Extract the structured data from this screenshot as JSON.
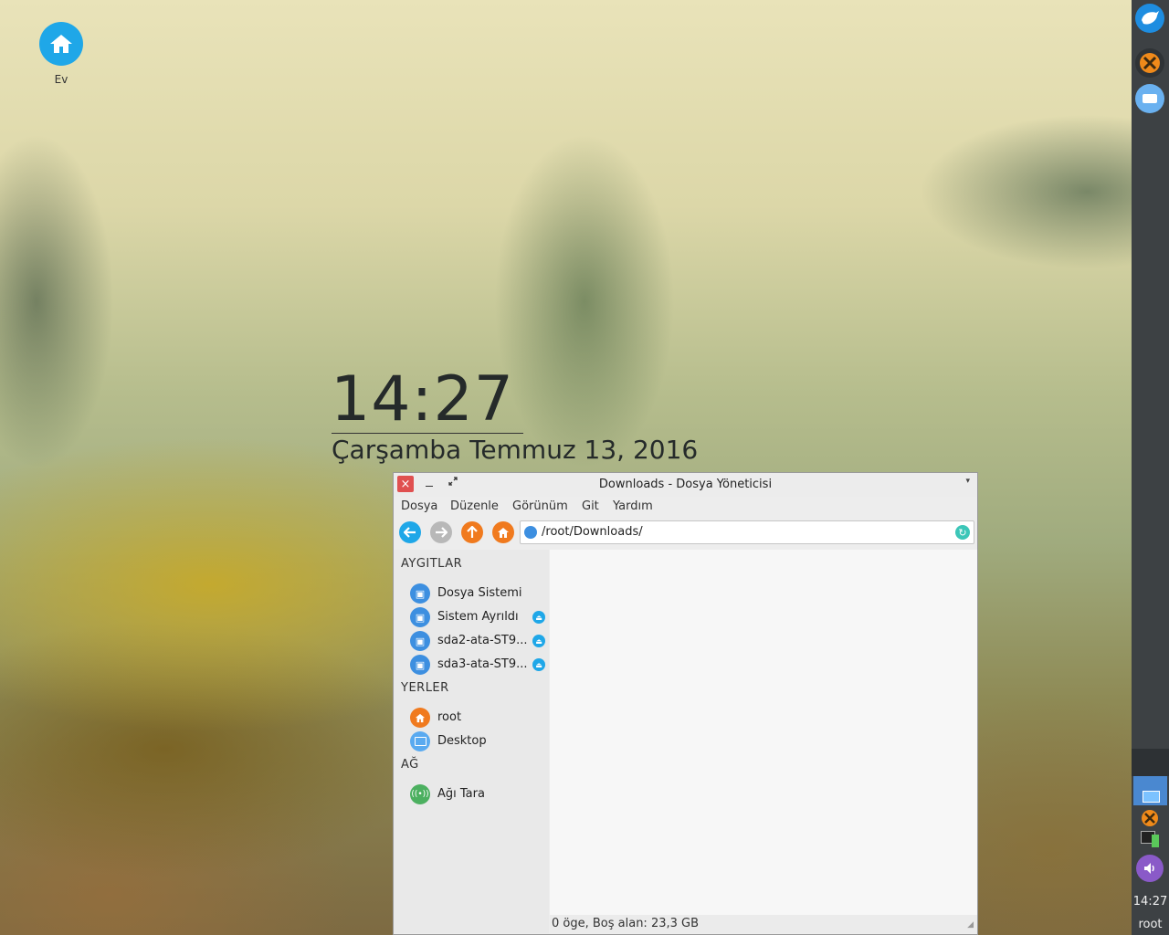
{
  "desktop": {
    "home_icon_label": "Ev"
  },
  "clock": {
    "time": "14:27",
    "date": "Çarşamba Temmuz 13, 2016"
  },
  "panel": {
    "time": "14:27",
    "user": "root"
  },
  "window": {
    "title": "Downloads - Dosya Yöneticisi",
    "close_glyph": "×",
    "menu": [
      "Dosya",
      "Düzenle",
      "Görünüm",
      "Git",
      "Yardım"
    ],
    "address": "/root/Downloads/",
    "sidebar": {
      "devices_header": "AYGITLAR",
      "devices": [
        {
          "label": "Dosya Sistemi",
          "eject": false
        },
        {
          "label": "Sistem Ayrıldı",
          "eject": true
        },
        {
          "label": "sda2-ata-ST9...",
          "eject": true
        },
        {
          "label": "sda3-ata-ST9...",
          "eject": true
        }
      ],
      "places_header": "YERLER",
      "places": [
        {
          "label": "root",
          "icon": "home-icon",
          "color": "#f07a1e"
        },
        {
          "label": "Desktop",
          "icon": "desktop-icon",
          "color": "#5aaaf0"
        }
      ],
      "network_header": "AĞ",
      "network": [
        {
          "label": "Ağı Tara",
          "icon": "network-icon",
          "color": "#4cb060"
        }
      ]
    },
    "status": "0 öge, Boş alan: 23,3 GB"
  },
  "colors": {
    "accent_blue": "#1fa7e8",
    "accent_orange": "#f07a1e",
    "close_red": "#e05050"
  }
}
